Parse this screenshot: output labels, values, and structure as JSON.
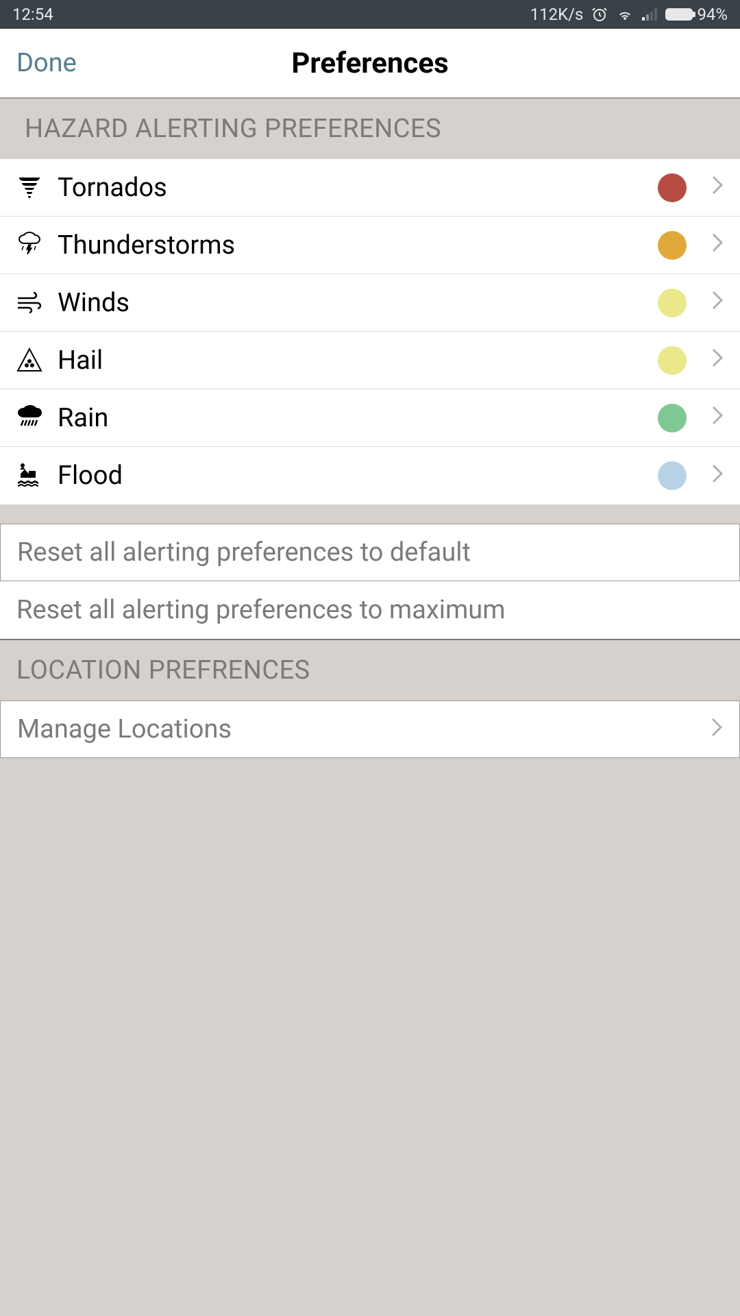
{
  "status_bar": {
    "time": "12:54",
    "network_speed": "112K/s",
    "battery_percent": "94%"
  },
  "nav": {
    "done": "Done",
    "title": "Preferences"
  },
  "sections": {
    "hazard_header": "HAZARD ALERTING PREFERENCES",
    "location_header": "LOCATION PREFRENCES"
  },
  "hazards": [
    {
      "label": "Tornados",
      "color": "#b64b41"
    },
    {
      "label": "Thunderstorms",
      "color": "#e1a839"
    },
    {
      "label": "Winds",
      "color": "#eae88a"
    },
    {
      "label": "Hail",
      "color": "#eae88a"
    },
    {
      "label": "Rain",
      "color": "#7fc894"
    },
    {
      "label": "Flood",
      "color": "#b7d2e5"
    }
  ],
  "actions": {
    "reset_default": "Reset all alerting preferences to default",
    "reset_max": "Reset all alerting preferences to maximum",
    "manage_locations": "Manage Locations"
  }
}
